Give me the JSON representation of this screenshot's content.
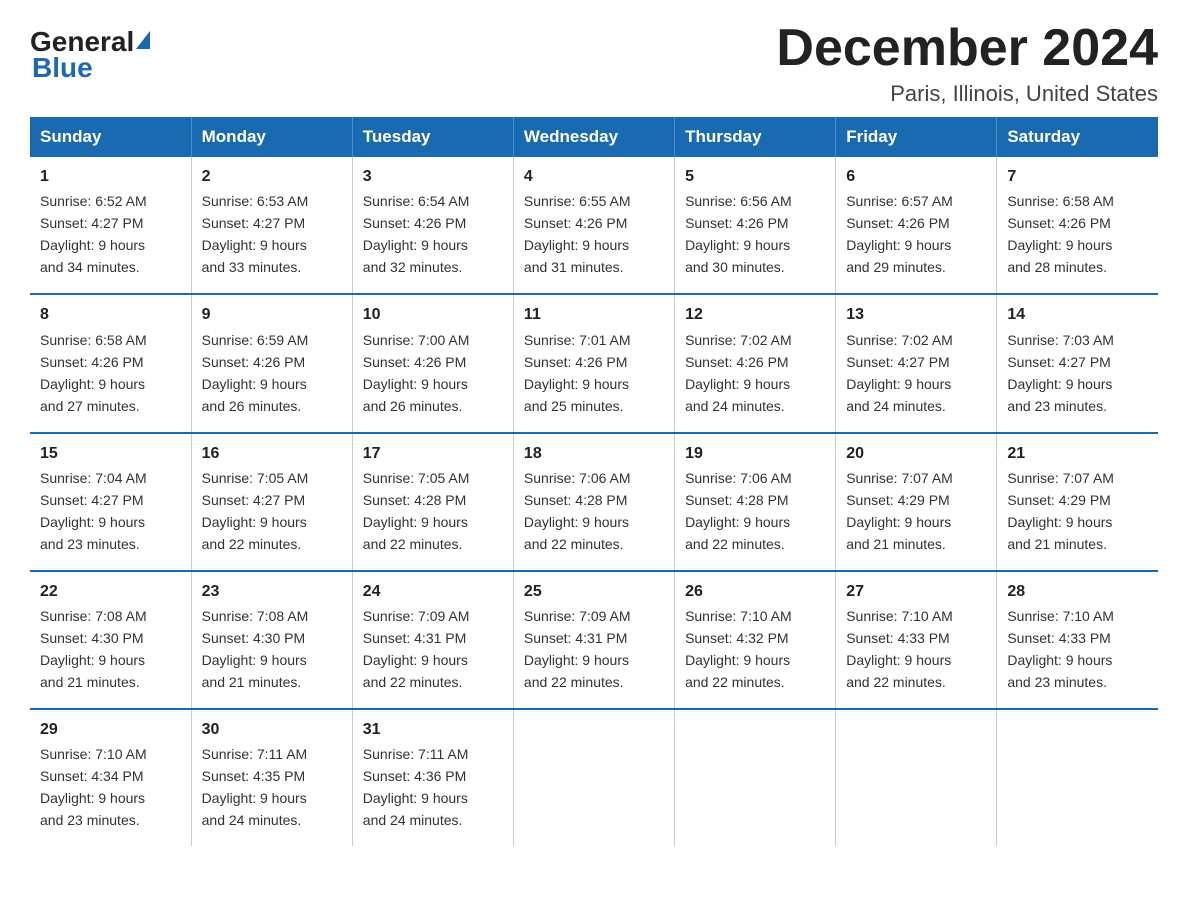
{
  "logo": {
    "general": "General",
    "blue": "Blue"
  },
  "title": "December 2024",
  "subtitle": "Paris, Illinois, United States",
  "days_header": [
    "Sunday",
    "Monday",
    "Tuesday",
    "Wednesday",
    "Thursday",
    "Friday",
    "Saturday"
  ],
  "weeks": [
    [
      {
        "num": "1",
        "sunrise": "6:52 AM",
        "sunset": "4:27 PM",
        "daylight": "9 hours and 34 minutes."
      },
      {
        "num": "2",
        "sunrise": "6:53 AM",
        "sunset": "4:27 PM",
        "daylight": "9 hours and 33 minutes."
      },
      {
        "num": "3",
        "sunrise": "6:54 AM",
        "sunset": "4:26 PM",
        "daylight": "9 hours and 32 minutes."
      },
      {
        "num": "4",
        "sunrise": "6:55 AM",
        "sunset": "4:26 PM",
        "daylight": "9 hours and 31 minutes."
      },
      {
        "num": "5",
        "sunrise": "6:56 AM",
        "sunset": "4:26 PM",
        "daylight": "9 hours and 30 minutes."
      },
      {
        "num": "6",
        "sunrise": "6:57 AM",
        "sunset": "4:26 PM",
        "daylight": "9 hours and 29 minutes."
      },
      {
        "num": "7",
        "sunrise": "6:58 AM",
        "sunset": "4:26 PM",
        "daylight": "9 hours and 28 minutes."
      }
    ],
    [
      {
        "num": "8",
        "sunrise": "6:58 AM",
        "sunset": "4:26 PM",
        "daylight": "9 hours and 27 minutes."
      },
      {
        "num": "9",
        "sunrise": "6:59 AM",
        "sunset": "4:26 PM",
        "daylight": "9 hours and 26 minutes."
      },
      {
        "num": "10",
        "sunrise": "7:00 AM",
        "sunset": "4:26 PM",
        "daylight": "9 hours and 26 minutes."
      },
      {
        "num": "11",
        "sunrise": "7:01 AM",
        "sunset": "4:26 PM",
        "daylight": "9 hours and 25 minutes."
      },
      {
        "num": "12",
        "sunrise": "7:02 AM",
        "sunset": "4:26 PM",
        "daylight": "9 hours and 24 minutes."
      },
      {
        "num": "13",
        "sunrise": "7:02 AM",
        "sunset": "4:27 PM",
        "daylight": "9 hours and 24 minutes."
      },
      {
        "num": "14",
        "sunrise": "7:03 AM",
        "sunset": "4:27 PM",
        "daylight": "9 hours and 23 minutes."
      }
    ],
    [
      {
        "num": "15",
        "sunrise": "7:04 AM",
        "sunset": "4:27 PM",
        "daylight": "9 hours and 23 minutes."
      },
      {
        "num": "16",
        "sunrise": "7:05 AM",
        "sunset": "4:27 PM",
        "daylight": "9 hours and 22 minutes."
      },
      {
        "num": "17",
        "sunrise": "7:05 AM",
        "sunset": "4:28 PM",
        "daylight": "9 hours and 22 minutes."
      },
      {
        "num": "18",
        "sunrise": "7:06 AM",
        "sunset": "4:28 PM",
        "daylight": "9 hours and 22 minutes."
      },
      {
        "num": "19",
        "sunrise": "7:06 AM",
        "sunset": "4:28 PM",
        "daylight": "9 hours and 22 minutes."
      },
      {
        "num": "20",
        "sunrise": "7:07 AM",
        "sunset": "4:29 PM",
        "daylight": "9 hours and 21 minutes."
      },
      {
        "num": "21",
        "sunrise": "7:07 AM",
        "sunset": "4:29 PM",
        "daylight": "9 hours and 21 minutes."
      }
    ],
    [
      {
        "num": "22",
        "sunrise": "7:08 AM",
        "sunset": "4:30 PM",
        "daylight": "9 hours and 21 minutes."
      },
      {
        "num": "23",
        "sunrise": "7:08 AM",
        "sunset": "4:30 PM",
        "daylight": "9 hours and 21 minutes."
      },
      {
        "num": "24",
        "sunrise": "7:09 AM",
        "sunset": "4:31 PM",
        "daylight": "9 hours and 22 minutes."
      },
      {
        "num": "25",
        "sunrise": "7:09 AM",
        "sunset": "4:31 PM",
        "daylight": "9 hours and 22 minutes."
      },
      {
        "num": "26",
        "sunrise": "7:10 AM",
        "sunset": "4:32 PM",
        "daylight": "9 hours and 22 minutes."
      },
      {
        "num": "27",
        "sunrise": "7:10 AM",
        "sunset": "4:33 PM",
        "daylight": "9 hours and 22 minutes."
      },
      {
        "num": "28",
        "sunrise": "7:10 AM",
        "sunset": "4:33 PM",
        "daylight": "9 hours and 23 minutes."
      }
    ],
    [
      {
        "num": "29",
        "sunrise": "7:10 AM",
        "sunset": "4:34 PM",
        "daylight": "9 hours and 23 minutes."
      },
      {
        "num": "30",
        "sunrise": "7:11 AM",
        "sunset": "4:35 PM",
        "daylight": "9 hours and 24 minutes."
      },
      {
        "num": "31",
        "sunrise": "7:11 AM",
        "sunset": "4:36 PM",
        "daylight": "9 hours and 24 minutes."
      },
      null,
      null,
      null,
      null
    ]
  ],
  "labels": {
    "sunrise": "Sunrise:",
    "sunset": "Sunset:",
    "daylight": "Daylight:"
  }
}
